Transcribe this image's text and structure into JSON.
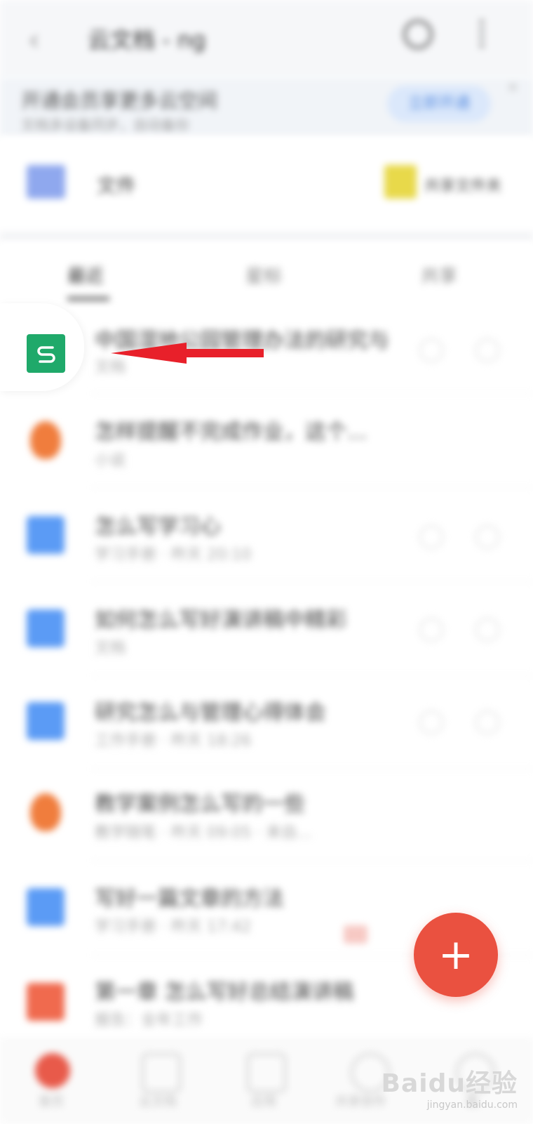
{
  "header": {
    "title": "云文档 - ng",
    "search_icon": "search-icon",
    "more_icon": "more-icon",
    "back_icon": "back-arrow-icon"
  },
  "banner": {
    "text": "开通会员享更多云空间",
    "subtext": "文档多设备同步，自动备份",
    "button": "立即开通"
  },
  "quick": {
    "left_label": "文件",
    "right_label": "共享文件夹"
  },
  "tabs": [
    "最近",
    "星标",
    "共享"
  ],
  "files": [
    {
      "title": "中国湿地公园管理办法的研究与",
      "sub": "文档",
      "type": "wps"
    },
    {
      "title": "怎样提醒不完成作业，这个...",
      "sub": "小说",
      "type": "orange"
    },
    {
      "title": "怎么写学习心",
      "sub": "学习手册 · 昨天 20:10",
      "type": "blue"
    },
    {
      "title": "如何怎么写好演讲稿中精彩",
      "sub": "文档",
      "type": "blue"
    },
    {
      "title": "研究怎么与管理心得体会",
      "sub": "工作手册 · 昨天 18:26",
      "type": "blue"
    },
    {
      "title": "教学案例怎么写的一些",
      "sub": "教学随笔 · 昨天 09:05 · 来自...",
      "type": "orange"
    },
    {
      "title": "写好一篇文章的方法",
      "sub": "学习手册 · 昨天 17:42",
      "type": "blue"
    },
    {
      "title": "第一章 怎么写好总结演讲稿",
      "sub": "报告：全年工作",
      "type": "red"
    }
  ],
  "wps": {
    "letter": "S",
    "icon": "wps-spreadsheet-icon",
    "color": "#1fa96a"
  },
  "fab": {
    "label": "+",
    "color": "#ea5140"
  },
  "nav": [
    "首页",
    "云文档",
    "应用",
    "共享协作",
    "我"
  ],
  "watermark": {
    "main": "Baidu经验",
    "sub": "jingyan.baidu.com"
  }
}
